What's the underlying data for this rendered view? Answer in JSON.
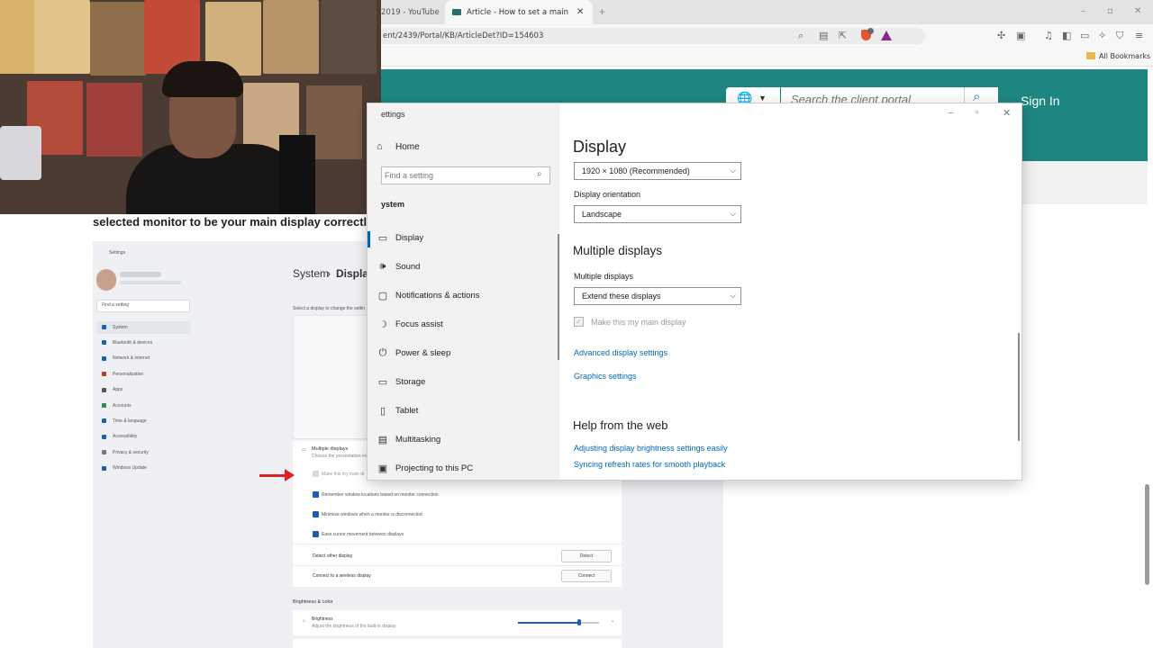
{
  "browser": {
    "tabs": [
      {
        "title": "2019 - YouTube"
      },
      {
        "title": "Article - How to set a main displ"
      }
    ],
    "new_tab_glyph": "+",
    "url": "ent/2439/Portal/KB/ArticleDet?ID=154603",
    "bookmarks": {
      "label": "All Bookmarks"
    },
    "window_controls": {
      "minimize": "–",
      "restore": "▫",
      "close": "✕"
    }
  },
  "portal": {
    "search_placeholder": "Search the client portal",
    "sign_in": "Sign In",
    "article_heading_visible": "selected monitor to be your main display correctl",
    "brand_color": "#1e8680"
  },
  "screenshot": {
    "window_title": "Settings",
    "breadcrumb_parent": "System",
    "breadcrumb_sep": "›",
    "breadcrumb_current": "Display",
    "find_placeholder": "Find a setting",
    "select_display_text": "Select a display to change the settin",
    "sidebar": [
      "System",
      "Bluetooth & devices",
      "Network & internet",
      "Personalization",
      "Apps",
      "Accounts",
      "Time & language",
      "Accessibility",
      "Privacy & security",
      "Windows Update"
    ],
    "multi_title": "Multiple displays",
    "multi_sub": "Choose the presentation mode",
    "options": [
      "Make this my main di",
      "Remember window locations based on monitor connection",
      "Minimize windows when a monitor is disconnected",
      "Ease cursor movement between displays"
    ],
    "detect_label": "Detect other display",
    "detect_btn": "Detect",
    "connect_label": "Connect to a wireless display",
    "connect_btn": "Connect",
    "brightness_section": "Brightness & color",
    "brightness_label": "Brightness",
    "brightness_sub": "Adjust the brightness of the built-in display",
    "brightness_level_percent": 76
  },
  "settings": {
    "window_title": "ettings",
    "home": "Home",
    "find_placeholder": "Find a setting",
    "system_label": "ystem",
    "nav": [
      {
        "label": "Display",
        "icon": "▭"
      },
      {
        "label": "Sound",
        "icon": "🕪"
      },
      {
        "label": "Notifications & actions",
        "icon": "▢"
      },
      {
        "label": "Focus assist",
        "icon": "☽"
      },
      {
        "label": "Power & sleep",
        "icon": "⏻"
      },
      {
        "label": "Storage",
        "icon": "▭"
      },
      {
        "label": "Tablet",
        "icon": "▯"
      },
      {
        "label": "Multitasking",
        "icon": "▤"
      },
      {
        "label": "Projecting to this PC",
        "icon": "▣"
      }
    ],
    "display_title": "Display",
    "resolution": "1920 × 1080 (Recommended)",
    "orientation_label": "Display orientation",
    "orientation": "Landscape",
    "multi_heading": "Multiple displays",
    "multi_label": "Multiple displays",
    "multi_value": "Extend these displays",
    "main_display_checkbox": "Make this my main display",
    "advanced_link": "Advanced display settings",
    "graphics_link": "Graphics settings",
    "help_heading": "Help from the web",
    "help_links": [
      "Adjusting display brightness settings easily",
      "Syncing refresh rates for smooth playback"
    ]
  }
}
